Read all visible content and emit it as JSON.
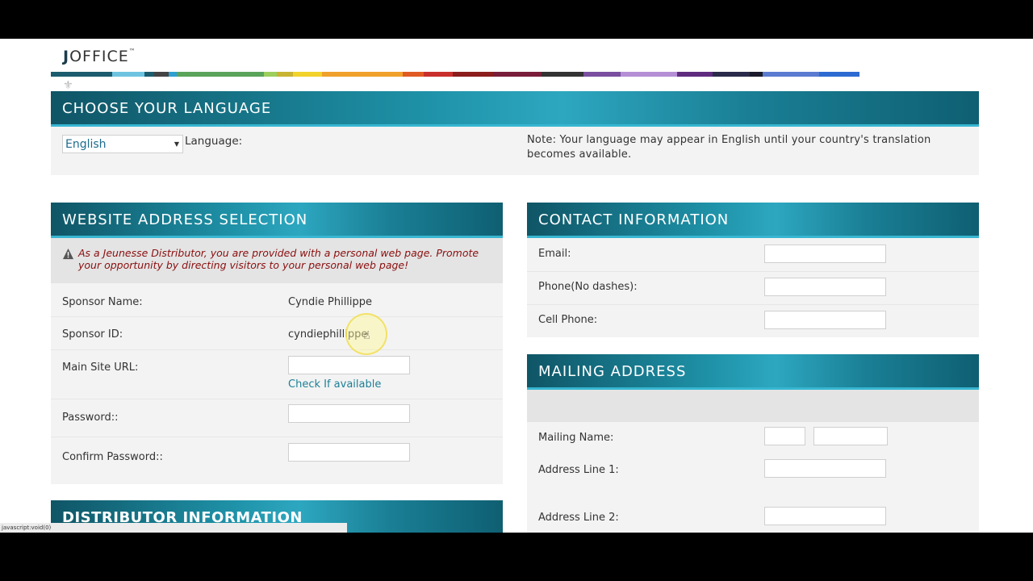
{
  "logo": {
    "j": "J",
    "rest": "OFFICE",
    "tm": "™"
  },
  "stripe_colors": [
    "#1b5c6e",
    "#6ec4e0",
    "#1b5c6e",
    "#444",
    "#2e9fd1",
    "#5aa45a",
    "#9ccf5c",
    "#c8b332",
    "#f2d22c",
    "#f0a02c",
    "#e05b24",
    "#c9302c",
    "#8b1d1d",
    "#7a1d3a",
    "#333",
    "#7a4fa0",
    "#b58fd6",
    "#5e2b7e",
    "#2a2a4a",
    "#1a1a2a",
    "#5a7bd0",
    "#2d6bd2"
  ],
  "language": {
    "title": "CHOOSE YOUR LANGUAGE",
    "selected": "English",
    "label": "Language:",
    "note": "Note: Your language may appear in English until your country's translation becomes available."
  },
  "website": {
    "title": "WEBSITE ADDRESS SELECTION",
    "alert": "As a Jeunesse Distributor, you are provided with a personal web page. Promote your opportunity by directing visitors to your personal web page!",
    "sponsor_name_label": "Sponsor Name:",
    "sponsor_name": "Cyndie Phillippe",
    "sponsor_id_label": "Sponsor ID:",
    "sponsor_id": "cyndiephillippe",
    "main_url_label": "Main Site URL:",
    "check_link": "Check If available",
    "password_label": "Password::",
    "confirm_label": "Confirm Password::"
  },
  "distributor": {
    "title": "DISTRIBUTOR INFORMATION"
  },
  "contact": {
    "title": "CONTACT INFORMATION",
    "email_label": "Email:",
    "phone_label": "Phone(No dashes):",
    "cell_label": "Cell Phone:"
  },
  "mailing": {
    "title": "MAILING ADDRESS",
    "name_label": "Mailing Name:",
    "addr1_label": "Address Line 1:",
    "addr2_label": "Address Line 2:"
  },
  "statusbar": {
    "text": "javascript:void(0)"
  }
}
